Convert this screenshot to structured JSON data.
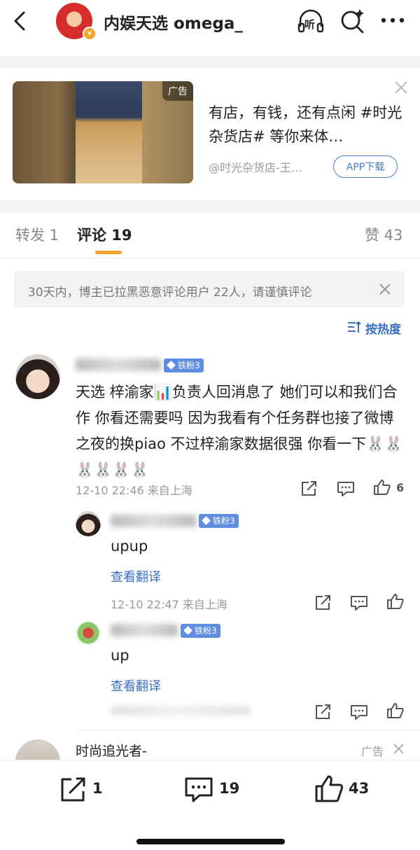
{
  "header": {
    "title": "内娱天选 omega_",
    "verified_badge": "v",
    "icons": [
      "back-icon",
      "listen-icon",
      "search-icon",
      "more-icon"
    ],
    "listen_label": "听"
  },
  "ad": {
    "tag": "广告",
    "text": "有店，有钱，还有点闲 #时光杂货店# 等你来体…",
    "source": "@时光杂货店-王…",
    "button": "APP下载"
  },
  "tabs": {
    "repost": "转发 1",
    "comments": "评论 19",
    "likes": "赞 43",
    "active": "comments",
    "accent": "#f7a22a"
  },
  "notice": {
    "text": "30天内，博主已拉黑恶意评论用户 22人，请谨慎评论"
  },
  "sort": {
    "label": "按热度"
  },
  "comment": {
    "fan_badge": "铁粉3",
    "text": "天选  梓渝家📊负责人回消息了  她们可以和我们合作  你看还需要吗  因为我看有个任务群也接了微博之夜的换piao  不过梓渝家数据很强  你看一下🐰🐰🐰🐰🐰🐰",
    "time": "12-10 22:46  来自上海",
    "likes": "6"
  },
  "replies": [
    {
      "fan_badge": "铁粉3",
      "text": "upup",
      "translate": "查看翻译",
      "time": "12-10 22:47  来自上海"
    },
    {
      "fan_badge": "铁粉3",
      "text": "up",
      "translate": "查看翻译",
      "time": ""
    }
  ],
  "next_item": {
    "name": "时尚追光者-",
    "tag": "广告"
  },
  "bottom_bar": {
    "reposts": "1",
    "comments": "19",
    "likes": "43"
  },
  "colors": {
    "link_blue": "#3a6fc4",
    "fan_badge": "#5f8de0",
    "tab_underline": "#f7a22a"
  }
}
